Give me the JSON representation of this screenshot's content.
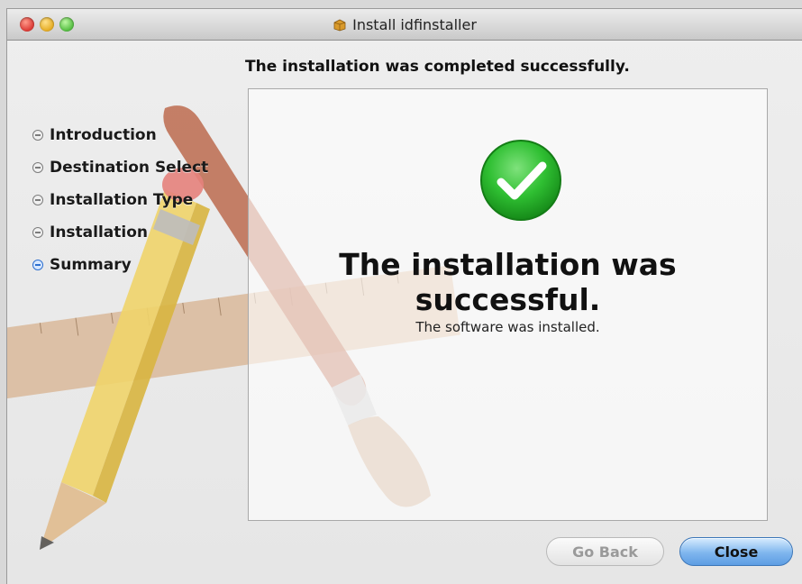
{
  "window": {
    "title": "Install idfinstaller",
    "title_icon": "package-icon"
  },
  "header": {
    "headline": "The installation was completed successfully."
  },
  "sidebar": {
    "items": [
      {
        "label": "Introduction",
        "state": "done"
      },
      {
        "label": "Destination Select",
        "state": "done"
      },
      {
        "label": "Installation Type",
        "state": "done"
      },
      {
        "label": "Installation",
        "state": "done"
      },
      {
        "label": "Summary",
        "state": "current"
      }
    ]
  },
  "main": {
    "status_icon": "success-check-icon",
    "title": "The installation was successful.",
    "message": "The software was installed."
  },
  "buttons": {
    "go_back": "Go Back",
    "close": "Close"
  },
  "colors": {
    "accent_blue": "#5d9de3",
    "success_green": "#2fbf32"
  }
}
